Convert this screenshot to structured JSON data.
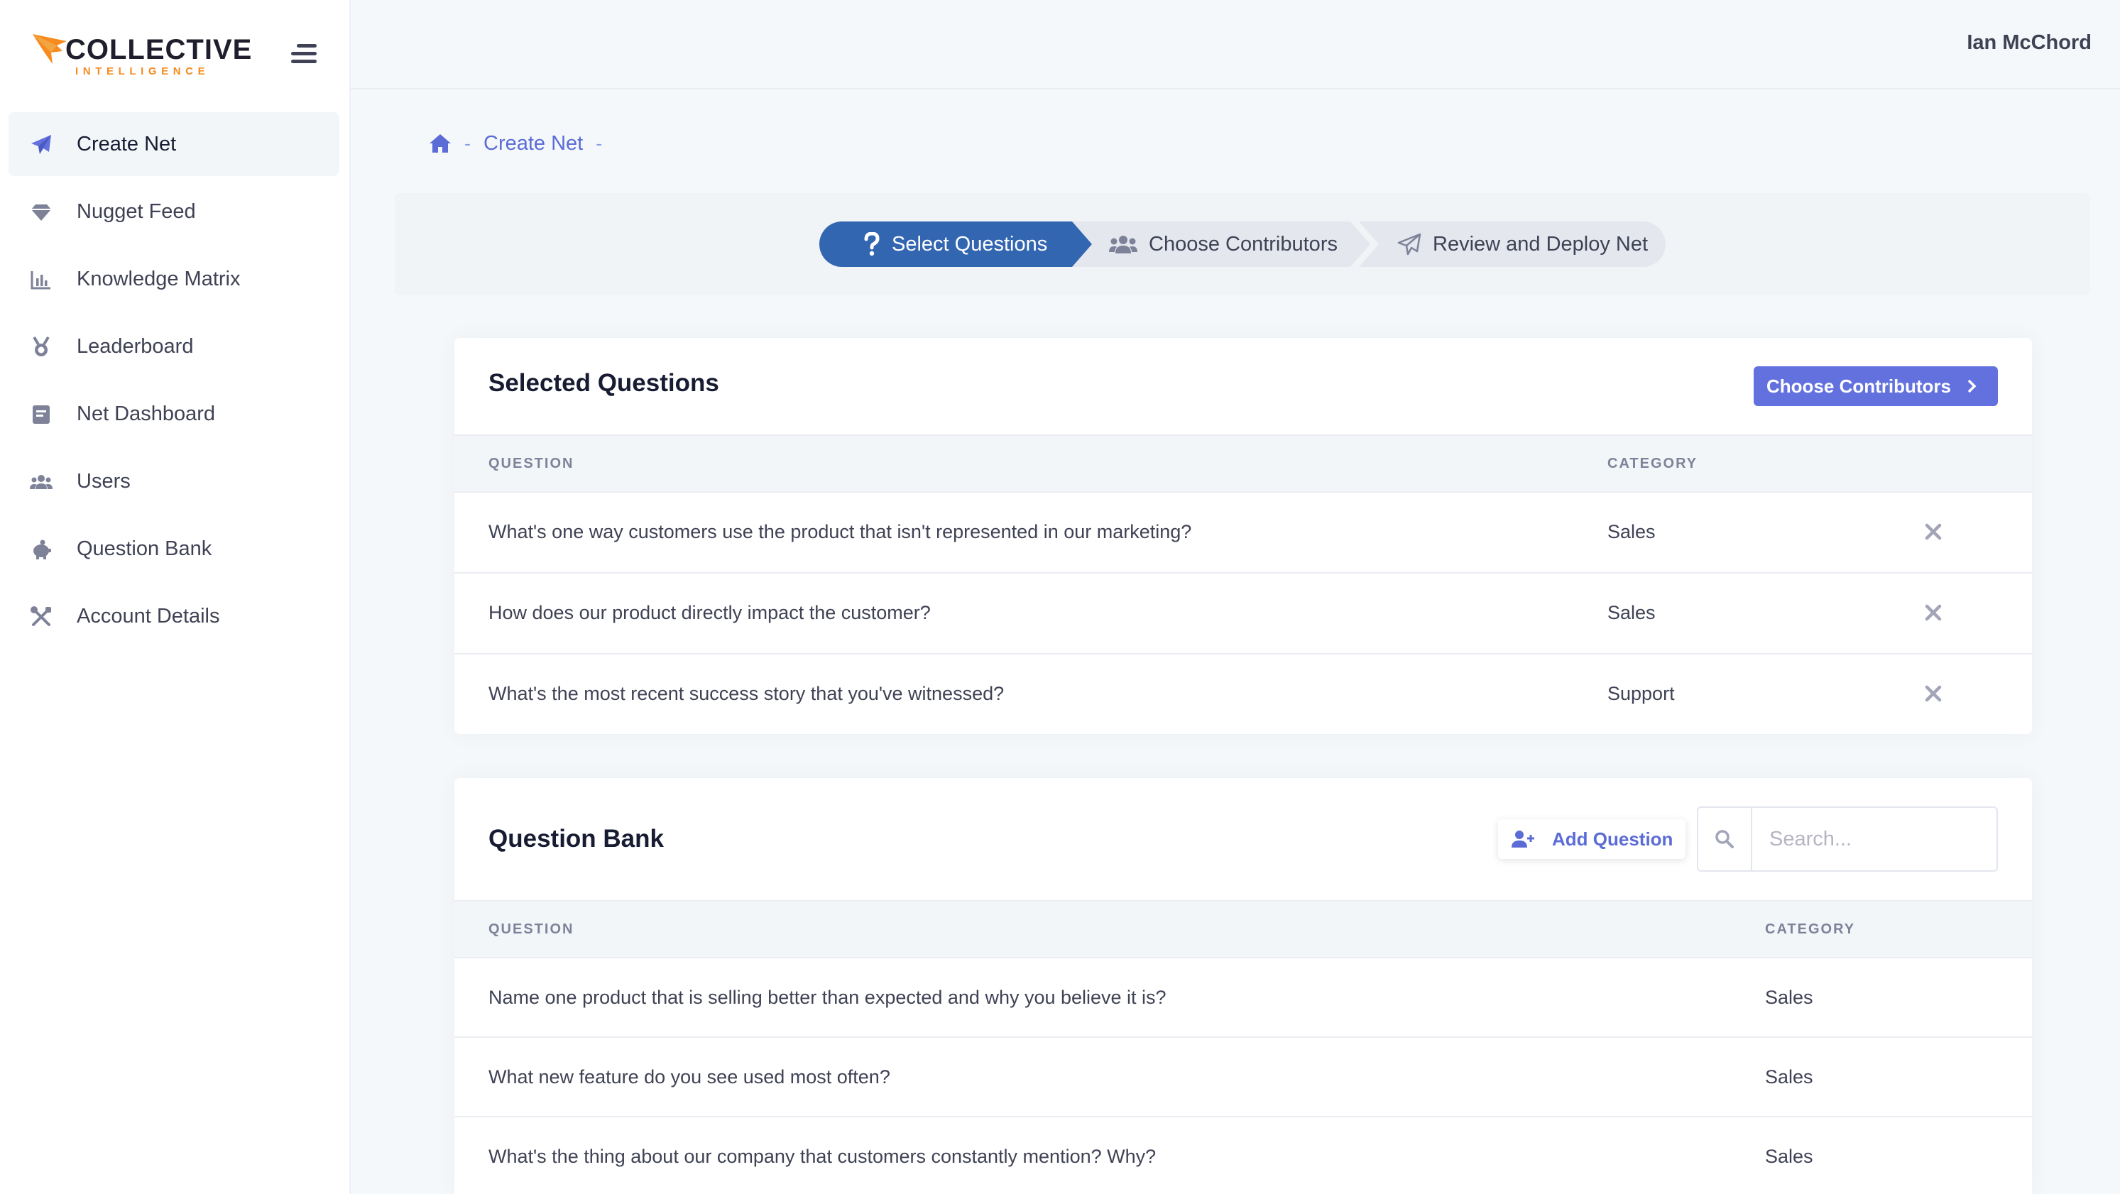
{
  "brand": {
    "name": "COLLECTIVE",
    "tagline": "INTELLIGENCE",
    "colors": {
      "orange": "#f68b1f",
      "dark": "#1e1e2d",
      "accent": "#6271de",
      "stepper_active": "#3366b0"
    }
  },
  "header": {
    "user_name": "Ian McChord"
  },
  "sidebar": {
    "items": [
      {
        "label": "Create Net",
        "icon": "paper-plane-icon",
        "active": true
      },
      {
        "label": "Nugget Feed",
        "icon": "gem-icon"
      },
      {
        "label": "Knowledge Matrix",
        "icon": "bar-chart-icon"
      },
      {
        "label": "Leaderboard",
        "icon": "medal-icon"
      },
      {
        "label": "Net Dashboard",
        "icon": "document-icon"
      },
      {
        "label": "Users",
        "icon": "users-icon"
      },
      {
        "label": "Question Bank",
        "icon": "piggy-bank-icon"
      },
      {
        "label": "Account Details",
        "icon": "tools-icon"
      }
    ]
  },
  "breadcrumb": {
    "home_icon": "home-icon",
    "separator": "-",
    "current": "Create Net"
  },
  "stepper": {
    "steps": [
      {
        "label": "Select Questions",
        "icon": "question-icon",
        "active": true
      },
      {
        "label": "Choose Contributors",
        "icon": "users-icon",
        "active": false
      },
      {
        "label": "Review and Deploy Net",
        "icon": "paper-plane-icon",
        "active": false
      }
    ]
  },
  "selected_questions": {
    "title": "Selected Questions",
    "button_label": "Choose Contributors",
    "columns": {
      "question": "QUESTION",
      "category": "CATEGORY"
    },
    "rows": [
      {
        "question": "What's one way customers use the product that isn't represented in our marketing?",
        "category": "Sales"
      },
      {
        "question": "How does our product directly impact the customer?",
        "category": "Sales"
      },
      {
        "question": "What's the most recent success story that you've witnessed?",
        "category": "Support"
      }
    ]
  },
  "question_bank": {
    "title": "Question Bank",
    "add_button_label": "Add Question",
    "search_placeholder": "Search...",
    "columns": {
      "question": "QUESTION",
      "category": "CATEGORY"
    },
    "rows": [
      {
        "question": "Name one product that is selling better than expected and why you believe it is?",
        "category": "Sales"
      },
      {
        "question": "What new feature do you see used most often?",
        "category": "Sales"
      },
      {
        "question": "What's the thing about our company that customers constantly mention? Why?",
        "category": "Sales"
      }
    ]
  }
}
